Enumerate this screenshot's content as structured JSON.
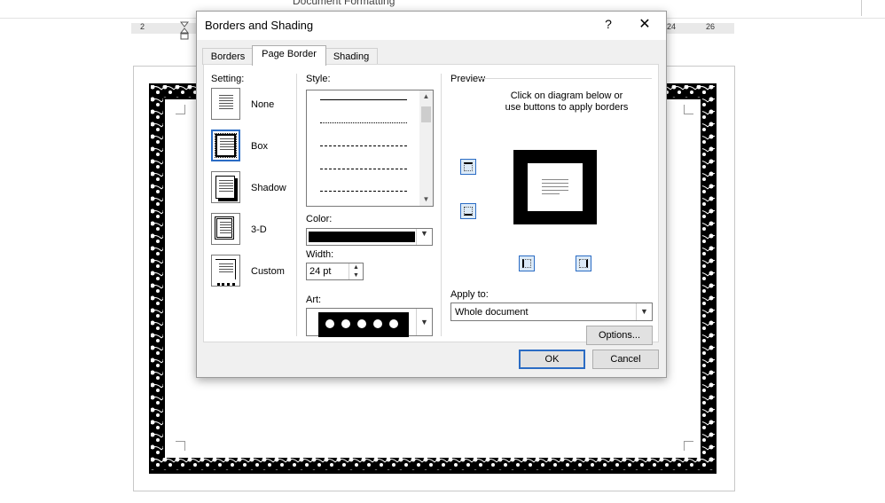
{
  "document": {
    "title": "Document Formatting",
    "ruler_numbers": [
      "2",
      "24",
      "26"
    ]
  },
  "dialog": {
    "title": "Borders and Shading",
    "help_glyph": "?",
    "close_glyph": "✕",
    "tabs": [
      {
        "label": "Borders",
        "active": false
      },
      {
        "label": "Page Border",
        "active": true
      },
      {
        "label": "Shading",
        "active": false
      }
    ],
    "setting": {
      "label": "Setting:",
      "options": [
        {
          "label": "None",
          "selected": false
        },
        {
          "label": "Box",
          "selected": true
        },
        {
          "label": "Shadow",
          "selected": false
        },
        {
          "label": "3-D",
          "selected": false
        },
        {
          "label": "Custom",
          "selected": false
        }
      ]
    },
    "style": {
      "label": "Style:"
    },
    "color": {
      "label": "Color:",
      "value": "#000000"
    },
    "width": {
      "label": "Width:",
      "value": "24 pt"
    },
    "art": {
      "label": "Art:"
    },
    "preview": {
      "label": "Preview",
      "instruction_line1": "Click on diagram below or",
      "instruction_line2": "use buttons to apply borders"
    },
    "apply_to": {
      "label": "Apply to:",
      "value": "Whole document"
    },
    "options_button": "Options...",
    "ok_button": "OK",
    "cancel_button": "Cancel"
  },
  "colors": {
    "accent": "#2b6cc4",
    "dialog_bg": "#f0f0f0",
    "border_art": "#000000"
  }
}
